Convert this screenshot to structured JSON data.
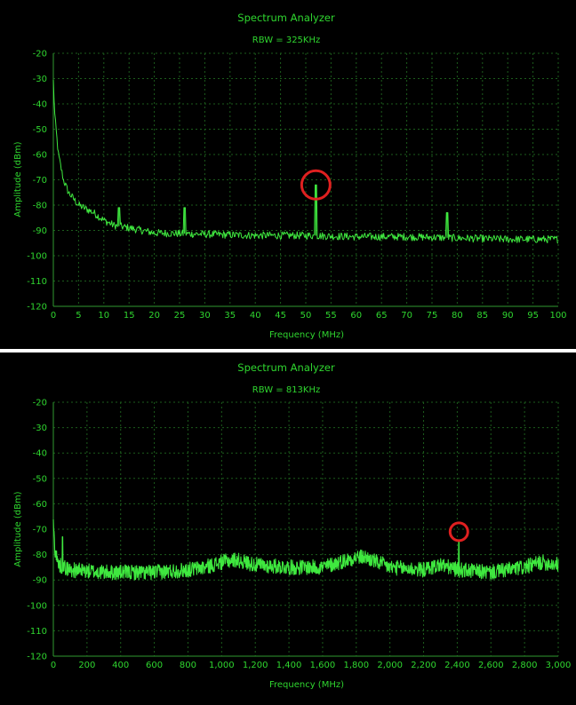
{
  "chart_data": [
    {
      "type": "line",
      "title": "Spectrum Analyzer",
      "subtitle": "RBW = 325KHz",
      "xlabel": "Frequency (MHz)",
      "ylabel": "Amplitude (dBm)",
      "xlim": [
        0,
        100
      ],
      "ylim": [
        -120,
        -20
      ],
      "xticks": [
        0,
        5,
        10,
        15,
        20,
        25,
        30,
        35,
        40,
        45,
        50,
        55,
        60,
        65,
        70,
        75,
        80,
        85,
        90,
        95,
        100
      ],
      "xtick_labels": [
        "0",
        "5",
        "10",
        "15",
        "20",
        "25",
        "30",
        "35",
        "40",
        "45",
        "50",
        "55",
        "60",
        "65",
        "70",
        "75",
        "80",
        "85",
        "90",
        "95",
        "100"
      ],
      "yticks": [
        -20,
        -30,
        -40,
        -50,
        -60,
        -70,
        -80,
        -90,
        -100,
        -110,
        -120
      ],
      "ytick_labels": [
        "-20",
        "-30",
        "-40",
        "-50",
        "-60",
        "-70",
        "-80",
        "-90",
        "-100",
        "-110",
        "-120"
      ],
      "grid": true,
      "line_color": "#3fe83f",
      "noise_floor": {
        "x": [
          0,
          0.3,
          1,
          2,
          3,
          5,
          8,
          10,
          12,
          15,
          20,
          30,
          40,
          50,
          60,
          70,
          80,
          90,
          100
        ],
        "y": [
          -31,
          -45,
          -60,
          -70,
          -75,
          -80,
          -83,
          -86,
          -88,
          -89,
          -91,
          -91.5,
          -92,
          -92,
          -92.5,
          -92.5,
          -93,
          -93.5,
          -93.5
        ],
        "jitter": 1.5
      },
      "peaks": [
        {
          "x": 13,
          "y": -81
        },
        {
          "x": 26,
          "y": -81
        },
        {
          "x": 52,
          "y": -72
        },
        {
          "x": 78,
          "y": -83
        }
      ],
      "marker": {
        "x": 52,
        "y": -72,
        "color": "#e02020"
      }
    },
    {
      "type": "line",
      "title": "Spectrum Analyzer",
      "subtitle": "RBW = 813KHz",
      "xlabel": "Frequency (MHz)",
      "ylabel": "Amplitude (dBm)",
      "xlim": [
        0,
        3000
      ],
      "ylim": [
        -120,
        -20
      ],
      "xticks": [
        0,
        200,
        400,
        600,
        800,
        1000,
        1200,
        1400,
        1600,
        1800,
        2000,
        2200,
        2400,
        2600,
        2800,
        3000
      ],
      "xtick_labels": [
        "0",
        "200",
        "400",
        "600",
        "800",
        "1,000",
        "1,200",
        "1,400",
        "1,600",
        "1,800",
        "2,000",
        "2,200",
        "2,400",
        "2,600",
        "2,800",
        "3,000"
      ],
      "yticks": [
        -20,
        -30,
        -40,
        -50,
        -60,
        -70,
        -80,
        -90,
        -100,
        -110,
        -120
      ],
      "ytick_labels": [
        "-20",
        "-30",
        "-40",
        "-50",
        "-60",
        "-70",
        "-80",
        "-90",
        "-100",
        "-110",
        "-120"
      ],
      "grid": true,
      "line_color": "#3fe83f",
      "noise_floor": {
        "x": [
          0,
          10,
          30,
          100,
          300,
          600,
          800,
          900,
          1000,
          1080,
          1200,
          1400,
          1600,
          1700,
          1800,
          1850,
          2000,
          2200,
          2300,
          2400,
          2600,
          2700,
          2800,
          2900,
          3000
        ],
        "y": [
          -68,
          -78,
          -84,
          -86,
          -87,
          -87,
          -86,
          -85,
          -83,
          -82,
          -84,
          -85,
          -85,
          -83,
          -81,
          -81,
          -85,
          -86,
          -84,
          -86,
          -87,
          -86,
          -85,
          -83,
          -84
        ],
        "jitter": 3
      },
      "peaks": [
        {
          "x": 55,
          "y": -73
        },
        {
          "x": 2410,
          "y": -75
        }
      ],
      "marker": {
        "x": 2410,
        "y": -71,
        "color": "#e02020"
      }
    }
  ]
}
